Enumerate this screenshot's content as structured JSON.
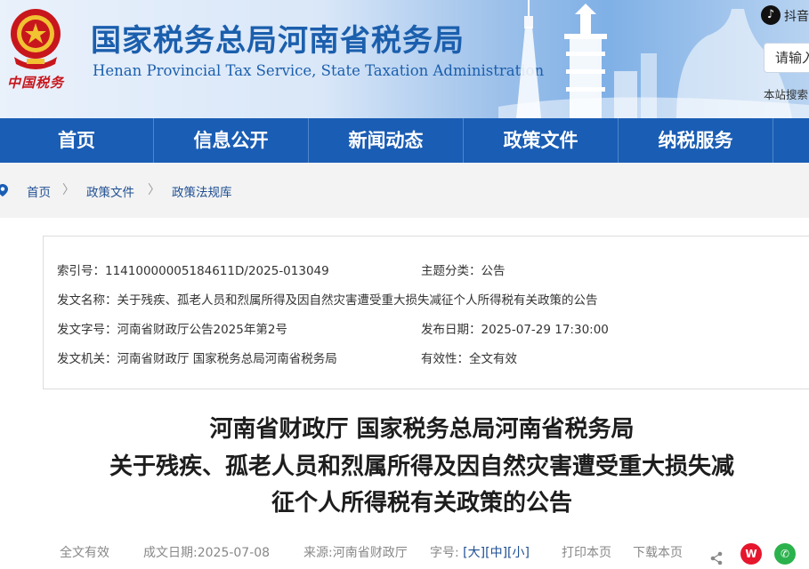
{
  "header": {
    "brand_script": "中国税务",
    "title": "国家税务总局河南省税务局",
    "subtitle": "Henan Provincial Tax Service, State Taxation Administration",
    "tiktok_label": "抖音",
    "search_placeholder": "请输入",
    "search_note": "本站搜索",
    "colors": {
      "title": "#1b5fad",
      "nav": "#1a5db4",
      "brand_red": "#c8161d"
    }
  },
  "nav": {
    "items": [
      {
        "label": "首页"
      },
      {
        "label": "信息公开"
      },
      {
        "label": "新闻动态"
      },
      {
        "label": "政策文件"
      },
      {
        "label": "纳税服务"
      }
    ]
  },
  "breadcrumb": {
    "items": [
      {
        "label": "首页"
      },
      {
        "label": "政策文件"
      },
      {
        "label": "政策法规库"
      }
    ],
    "separator": "〉"
  },
  "info": {
    "index_label": "索引号：",
    "index_value": "11410000005184611D/2025-013049",
    "topic_label": "主题分类：",
    "topic_value": "公告",
    "name_label": "发文名称：",
    "name_value": "关于残疾、孤老人员和烈属所得及因自然灾害遭受重大损失减征个人所得税有关政策的公告",
    "doc_no_label": "发文字号：",
    "doc_no_value": "河南省财政厅公告2025年第2号",
    "publish_label": "发布日期：",
    "publish_value": "2025-07-29 17:30:00",
    "issuer_label": "发文机关：",
    "issuer_value": "河南省财政厅 国家税务总局河南省税务局",
    "validity_label": "有效性：",
    "validity_value": "全文有效"
  },
  "article": {
    "title_lines": [
      "河南省财政厅 国家税务总局河南省税务局",
      "关于残疾、孤老人员和烈属所得及因自然灾害遭受重大损失减",
      "征个人所得税有关政策的公告"
    ]
  },
  "meta": {
    "validity": "全文有效",
    "date": "成文日期:2025-07-08",
    "source": "来源:河南省财政厅",
    "font_size_label": "字号:",
    "size_large": "[大]",
    "size_medium": "[中]",
    "size_small": "[小]",
    "print": "打印本页",
    "download": "下载本页",
    "share_icons": {
      "weibo": "weibo-icon",
      "wechat": "wechat-icon",
      "share": "share-icon"
    }
  }
}
